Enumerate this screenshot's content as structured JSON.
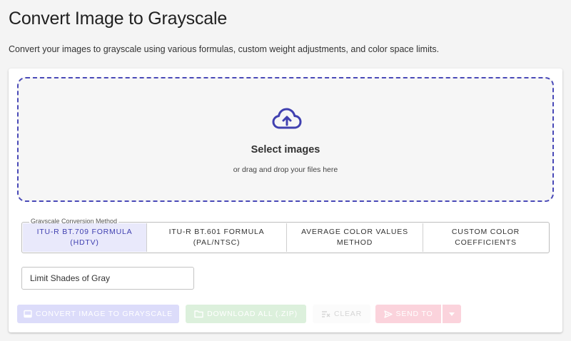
{
  "header": {
    "title": "Convert Image to Grayscale",
    "description": "Convert your images to grayscale using various formulas, custom weight adjustments, and color space limits."
  },
  "dropzone": {
    "title": "Select images",
    "subtitle": "or drag and drop your files here",
    "icon": "cloud-upload-icon"
  },
  "method": {
    "legend": "Grayscale Conversion Method",
    "tabs": [
      {
        "line1": "ITU-R BT.709 Formula",
        "line2": "(HDTV)",
        "active": true
      },
      {
        "line1": "ITU-R BT.601 Formula",
        "line2": "(PAL/NTSC)",
        "active": false
      },
      {
        "line1": "Average Color Values",
        "line2": "Method",
        "active": false
      },
      {
        "line1": "Custom Color",
        "line2": "Coefficients",
        "active": false
      }
    ]
  },
  "shades": {
    "value": "Limit Shades of Gray"
  },
  "actions": {
    "convert_label": "Convert Image to Grayscale",
    "download_label": "Download All (.zip)",
    "clear_label": "Clear",
    "send_label": "Send To"
  },
  "colors": {
    "accent": "#4040b0",
    "dropzone_border": "#4a4ab8",
    "active_tab_bg": "#e9e9fb"
  }
}
